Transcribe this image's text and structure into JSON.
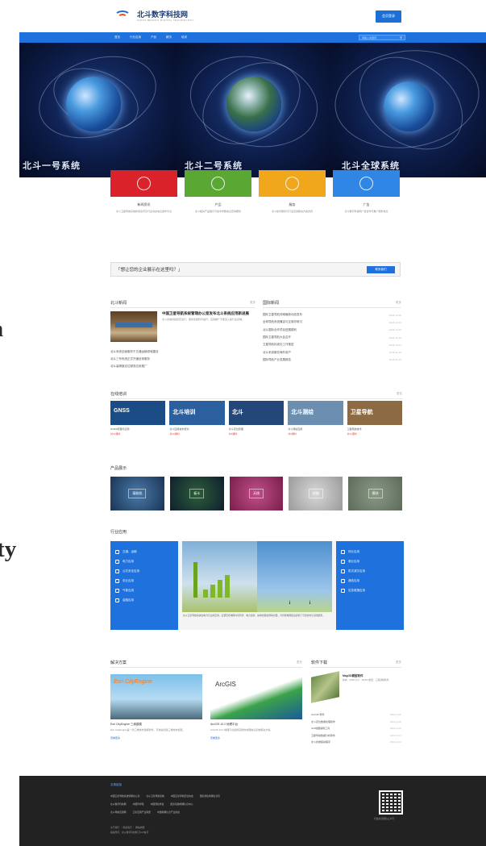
{
  "side_fragments": [
    "n",
    "ity"
  ],
  "header": {
    "brand": "北斗数字科技网",
    "brand_sub": "CHINA BEIDOU DIGITAL TECHNOLOGY",
    "login_label": "会员登录"
  },
  "nav": {
    "items": [
      "首页",
      "行业应用",
      "产品",
      "解决",
      "培训"
    ],
    "search_placeholder": "请输入关键词"
  },
  "banner": {
    "captions": [
      "北斗一号系统",
      "北斗二号系统",
      "北斗全球系统"
    ]
  },
  "cards": [
    {
      "title": "新闻资讯",
      "desc": "北斗卫星导航系统新闻资讯及行业动态信息发布平台",
      "color": "#d9222a"
    },
    {
      "title": "产品",
      "desc": "北斗相关产品展示与技术参数信息查询服务",
      "color": "#5aa833"
    },
    {
      "title": "服务",
      "desc": "北斗技术服务与行业应用解决方案支持",
      "color": "#f0a71c"
    },
    {
      "title": "广告",
      "desc": "北斗数字科技网广告合作与推广服务信息",
      "color": "#2f86e4"
    }
  ],
  "call": {
    "text": "「想让您的企业展示在这里吗？」",
    "button": "联系我们"
  },
  "news": {
    "title": "北斗新闻",
    "more": "更多",
    "feature_title": "中国卫星导航系统管理办公室发布北斗系统应用新进展",
    "feature_summary": "北斗系统持续稳定运行，服务性能稳步提升，应用推广不断深入各行业领域。",
    "items": [
      "北斗系统全面服务于交通运输领域建设",
      "北斗三号系统正式开通全球服务",
      "北斗高精度定位服务应用推广"
    ]
  },
  "industry": {
    "title": "国际新闻",
    "more": "更多",
    "rows": [
      {
        "text": "国际卫星导航领域最新动态发布",
        "date": "2018-12-05"
      },
      {
        "text": "全球导航系统兼容与互操作研讨",
        "date": "2018-12-04"
      },
      {
        "text": "北斗国际合作项目进展顺利",
        "date": "2018-12-03"
      },
      {
        "text": "国际卫星导航大会召开",
        "date": "2018-12-02"
      },
      {
        "text": "卫星导航标准化工作推进",
        "date": "2018-12-01"
      },
      {
        "text": "北斗系统服务海外用户",
        "date": "2018-11-30"
      },
      {
        "text": "国际导航产业发展报告",
        "date": "2018-11-29"
      }
    ]
  },
  "courses": {
    "title": "在线培训",
    "more": "更多",
    "items": [
      {
        "label": "GNSS",
        "title": "GNSS原理与应用",
        "meta": "共12课时",
        "color": "#1c4c86"
      },
      {
        "label": "北斗培训",
        "title": "北斗应用技术培训",
        "meta": "共10课时",
        "color": "#2b5f9e"
      },
      {
        "label": "北斗",
        "title": "北斗定位原理",
        "meta": "共8课时",
        "color": "#24477a"
      },
      {
        "label": "北斗测绘",
        "title": "北斗测绘应用",
        "meta": "共9课时",
        "color": "#6c8eb0"
      },
      {
        "label": "卫星导航",
        "title": "卫星导航技术",
        "meta": "共11课时",
        "color": "#8b6a44"
      }
    ]
  },
  "products": {
    "title": "产品展示",
    "items": [
      {
        "label": "接收机",
        "color": "#1a3556"
      },
      {
        "label": "板卡",
        "color": "#0e1f2e"
      },
      {
        "label": "天线",
        "color": "#7a1e4a"
      },
      {
        "label": "终端",
        "color": "#9a9a9a"
      },
      {
        "label": "模块",
        "color": "#5e6a5a"
      }
    ]
  },
  "apps": {
    "title": "行业应用",
    "left": [
      "交通、运输",
      "电力应用",
      "公共安全应用",
      "农业应用",
      "气象应用",
      "金融应用"
    ],
    "right": [
      "林业应用",
      "渔业应用",
      "防灾减灾应用",
      "通信应用",
      "应急救援应用"
    ],
    "caption": "北斗卫星导航系统在电力行业的应用，主要包括电网时间同步、电力巡检、输电线路监测等方面，为智能电网建设提供了可靠的时空基准服务。"
  },
  "solutions": {
    "title": "解决方案",
    "more": "更多",
    "items": [
      {
        "img_text": "Esri CityEngine",
        "title": "Esri CityEngine 三维建模",
        "desc": "Esri CityEngine是一款三维城市建模软件，可快速创建三维城市模型。",
        "more": "查看更多"
      },
      {
        "img_text": "ArcGIS",
        "title": "ArcGIS 10.2 地理平台",
        "desc": "ArcGIS 10.2 地理平台提供完整的地理信息系统解决方案。",
        "more": "查看更多"
      }
    ]
  },
  "downloads": {
    "title": "软件下载",
    "more": "更多",
    "feature_title": "Map3D模型软件",
    "feature_desc": "版本：2018 大小：28.6M 类型：三维建模软件",
    "rows": [
      {
        "text": "ArcGIS 软件",
        "date": "2018-11-20"
      },
      {
        "text": "北斗定位数据处理软件",
        "date": "2018-11-18"
      },
      {
        "text": "GIS地图编辑工具",
        "date": "2018-11-16"
      },
      {
        "text": "卫星导航数据分析软件",
        "date": "2018-11-14"
      },
      {
        "text": "北斗终端驱动程序",
        "date": "2018-11-12"
      }
    ]
  },
  "footer": {
    "title": "友情链接",
    "links": [
      [
        "中国卫星导航系统管理办公室",
        "北斗卫星导航系统",
        "中国卫星导航定位协会",
        "国家测绘地理信息局"
      ],
      [
        "北斗数字科技网",
        "中国科学院",
        "中国测绘学会",
        "国家基础地理信息中心"
      ],
      [
        "北斗导航应用网",
        "卫星应用产业联盟",
        "中国地理信息产业协会"
      ]
    ],
    "bottom": [
      "关于我们 ｜ 联系我们 ｜ 网站地图",
      "版权所有：北斗数字科技网 京ICP备号"
    ],
    "qr_caption": "扫描关注微信公众号"
  }
}
